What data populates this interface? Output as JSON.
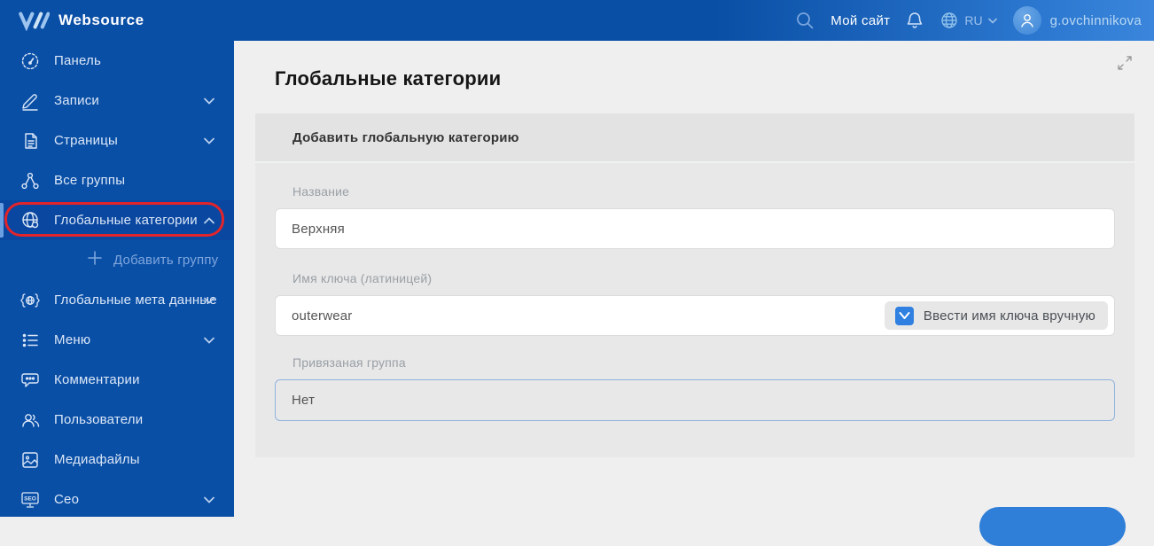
{
  "brand": {
    "name": "Websource"
  },
  "topbar": {
    "my_site_label": "Мой сайт",
    "language": "RU",
    "username": "g.ovchinnikova"
  },
  "sidebar": {
    "items": [
      {
        "label": "Панель",
        "icon": "gauge-icon",
        "chevron": "none"
      },
      {
        "label": "Записи",
        "icon": "pencil-icon",
        "chevron": "down"
      },
      {
        "label": "Страницы",
        "icon": "pages-icon",
        "chevron": "down"
      },
      {
        "label": "Все группы",
        "icon": "group-icon",
        "chevron": "none"
      },
      {
        "label": "Глобальные категории",
        "icon": "globe-icon",
        "chevron": "up",
        "active": true,
        "annotated": true
      },
      {
        "label": "Добавить группу",
        "icon": "plus-icon",
        "submenu": true
      },
      {
        "label": "Глобальные мета данные",
        "icon": "meta-icon",
        "chevron": "down"
      },
      {
        "label": "Меню",
        "icon": "menu-list-icon",
        "chevron": "down"
      },
      {
        "label": "Комментарии",
        "icon": "comments-icon",
        "chevron": "none"
      },
      {
        "label": "Пользователи",
        "icon": "users-icon",
        "chevron": "none"
      },
      {
        "label": "Медиафайлы",
        "icon": "media-icon",
        "chevron": "none"
      },
      {
        "label": "Сео",
        "icon": "seo-icon",
        "chevron": "down"
      }
    ]
  },
  "main": {
    "title": "Глобальные категории",
    "card": {
      "header": "Добавить глобальную категорию",
      "fields": [
        {
          "label": "Название",
          "value": "Верхняя"
        },
        {
          "label": "Имя ключа (латиницей)",
          "value": "outerwear",
          "checkbox_label": "Ввести имя ключа вручную",
          "checkbox_checked": true
        },
        {
          "label": "Привязаная группа",
          "value": "Нет"
        }
      ]
    }
  },
  "colors": {
    "sidebar_blue": "#0a4fa6",
    "topbar_gradient_end": "#3b86dc",
    "checkbox_blue": "#2f80e0",
    "annotation_red": "#e2242b",
    "select_border_blue": "#8fb3de",
    "submit_button_blue": "#2f7ed8",
    "page_background": "#efefef",
    "card_background": "#e8e8e8"
  }
}
